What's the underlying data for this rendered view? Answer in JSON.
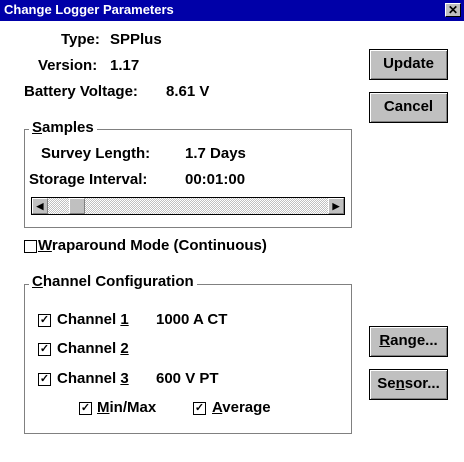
{
  "window": {
    "title": "Change Logger Parameters",
    "close_glyph": "✕"
  },
  "info": {
    "type_label": "Type:",
    "type_value": "SPPlus",
    "version_label": "Version:",
    "version_value": "1.17",
    "battery_label": "Battery Voltage:",
    "battery_value": "8.61 V"
  },
  "buttons": {
    "update": "Update",
    "cancel": "Cancel",
    "range": {
      "before": "",
      "mnemonic": "R",
      "after": "ange..."
    },
    "sensor": {
      "before": "Se",
      "mnemonic": "n",
      "after": "sor..."
    }
  },
  "samples": {
    "group": {
      "mnemonic": "S",
      "after": "amples"
    },
    "survey_label": "Survey Length:",
    "survey_value": "1.7 Days",
    "storage_label": "Storage Interval:",
    "storage_value": "00:01:00",
    "scroll_left_glyph": "◀",
    "scroll_right_glyph": "▶"
  },
  "wraparound": {
    "checked": false,
    "mnemonic": "W",
    "after": "raparound Mode (Continuous)"
  },
  "channels": {
    "group": {
      "mnemonic": "C",
      "after": "hannel Configuration"
    },
    "ch1": {
      "checked": true,
      "before": "Channel ",
      "mnemonic": "1",
      "desc": "1000 A CT"
    },
    "ch2": {
      "checked": true,
      "before": "Channel ",
      "mnemonic": "2",
      "desc": ""
    },
    "ch3": {
      "checked": true,
      "before": "Channel ",
      "mnemonic": "3",
      "desc": "600 V PT"
    },
    "minmax": {
      "checked": true,
      "mnemonic": "M",
      "after": "in/Max"
    },
    "average": {
      "checked": true,
      "mnemonic": "A",
      "after": "verage"
    },
    "check_glyph": "✓"
  }
}
